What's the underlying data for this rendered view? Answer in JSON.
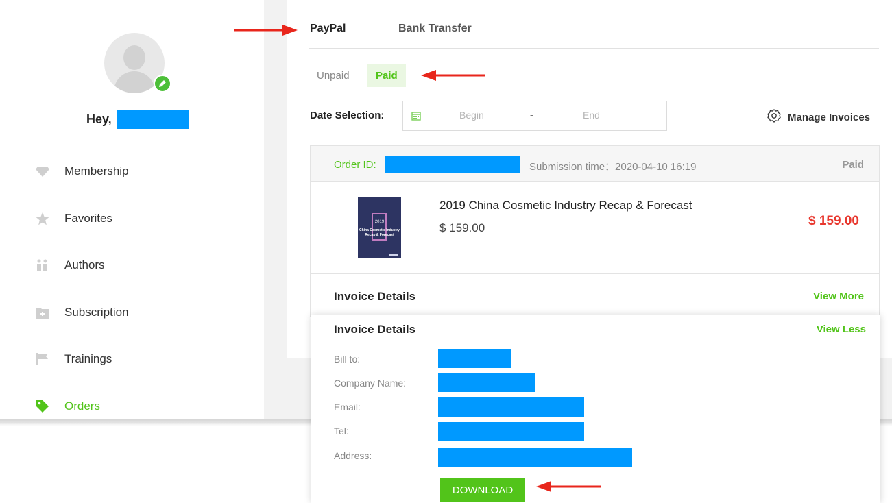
{
  "sidebar": {
    "greeting": "Hey,",
    "nav": [
      {
        "label": "Membership",
        "icon": "diamond-icon"
      },
      {
        "label": "Favorites",
        "icon": "star-icon"
      },
      {
        "label": "Authors",
        "icon": "people-icon"
      },
      {
        "label": "Subscription",
        "icon": "folder-plus-icon"
      },
      {
        "label": "Trainings",
        "icon": "flag-icon"
      },
      {
        "label": "Orders",
        "icon": "tag-icon",
        "active": true
      }
    ]
  },
  "payment_tabs": [
    {
      "label": "PayPal",
      "active": true
    },
    {
      "label": "Bank Transfer",
      "active": false
    }
  ],
  "status_tabs": [
    {
      "label": "Unpaid",
      "active": false
    },
    {
      "label": "Paid",
      "active": true
    }
  ],
  "date_filter": {
    "label": "Date Selection:",
    "begin_placeholder": "Begin",
    "separator": "-",
    "end_placeholder": "End"
  },
  "manage_invoices_label": "Manage Invoices",
  "order": {
    "id_label": "Order ID:",
    "submission_time": "Submission time：2020-04-10 16:19",
    "status": "Paid",
    "product": {
      "cover_year": "2019",
      "cover_line1": "China Cosmetic Industry",
      "cover_line2": "Recap & Forecast",
      "title": "2019 China Cosmetic Industry Recap & Forecast",
      "price": "$ 159.00"
    },
    "total": "$ 159.00",
    "invoice_details_label": "Invoice Details",
    "view_more_label": "View More"
  },
  "invoice": {
    "title": "Invoice Details",
    "view_less_label": "View Less",
    "fields": [
      {
        "label": "Bill to:"
      },
      {
        "label": "Company Name:"
      },
      {
        "label": "Email:"
      },
      {
        "label": "Tel:"
      },
      {
        "label": "Address:"
      }
    ],
    "download_label": "DOWNLOAD"
  },
  "colors": {
    "accent_green": "#52c41a",
    "price_red": "#e8372e",
    "redaction_blue": "#0099ff",
    "annotation_arrow_red": "#e8261c"
  }
}
